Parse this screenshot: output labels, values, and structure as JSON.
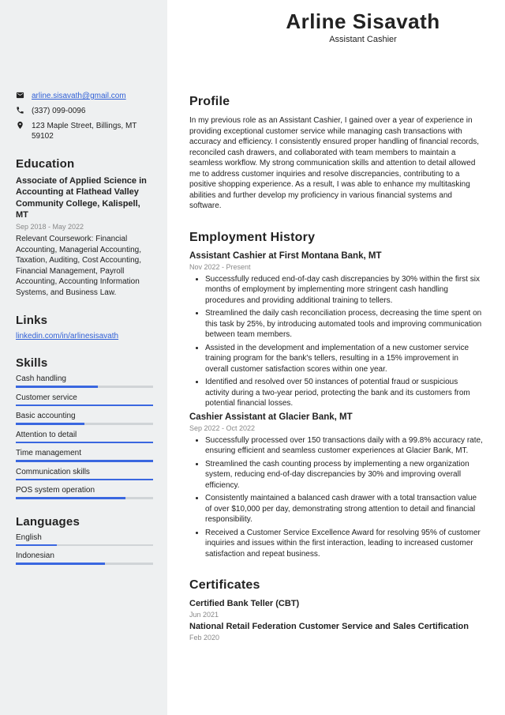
{
  "header": {
    "name": "Arline Sisavath",
    "title": "Assistant Cashier"
  },
  "contact": {
    "email": "arline.sisavath@gmail.com",
    "phone": "(337) 099-0096",
    "address": "123 Maple Street, Billings, MT 59102"
  },
  "education": {
    "heading": "Education",
    "degree": "Associate of Applied Science in Accounting at Flathead Valley Community College, Kalispell, MT",
    "dates": "Sep 2018 - May 2022",
    "coursework": "Relevant Coursework: Financial Accounting, Managerial Accounting, Taxation, Auditing, Cost Accounting, Financial Management, Payroll Accounting, Accounting Information Systems, and Business Law."
  },
  "links": {
    "heading": "Links",
    "url": "linkedin.com/in/arlinesisavath"
  },
  "skills": {
    "heading": "Skills",
    "items": [
      {
        "name": "Cash handling",
        "level": 60
      },
      {
        "name": "Customer service",
        "level": 100
      },
      {
        "name": "Basic accounting",
        "level": 50
      },
      {
        "name": "Attention to detail",
        "level": 100
      },
      {
        "name": "Time management",
        "level": 100
      },
      {
        "name": "Communication skills",
        "level": 100
      },
      {
        "name": "POS system operation",
        "level": 80
      }
    ]
  },
  "languages": {
    "heading": "Languages",
    "items": [
      {
        "name": "English",
        "level": 30
      },
      {
        "name": "Indonesian",
        "level": 65
      }
    ]
  },
  "profile": {
    "heading": "Profile",
    "text": "In my previous role as an Assistant Cashier, I gained over a year of experience in providing exceptional customer service while managing cash transactions with accuracy and efficiency. I consistently ensured proper handling of financial records, reconciled cash drawers, and collaborated with team members to maintain a seamless workflow. My strong communication skills and attention to detail allowed me to address customer inquiries and resolve discrepancies, contributing to a positive shopping experience. As a result, I was able to enhance my multitasking abilities and further develop my proficiency in various financial systems and software."
  },
  "employment": {
    "heading": "Employment History",
    "jobs": [
      {
        "title": "Assistant Cashier at First Montana Bank, MT",
        "dates": "Nov 2022 - Present",
        "bullets": [
          "Successfully reduced end-of-day cash discrepancies by 30% within the first six months of employment by implementing more stringent cash handling procedures and providing additional training to tellers.",
          "Streamlined the daily cash reconciliation process, decreasing the time spent on this task by 25%, by introducing automated tools and improving communication between team members.",
          "Assisted in the development and implementation of a new customer service training program for the bank's tellers, resulting in a 15% improvement in overall customer satisfaction scores within one year.",
          "Identified and resolved over 50 instances of potential fraud or suspicious activity during a two-year period, protecting the bank and its customers from potential financial losses."
        ]
      },
      {
        "title": "Cashier Assistant at Glacier Bank, MT",
        "dates": "Sep 2022 - Oct 2022",
        "bullets": [
          "Successfully processed over 150 transactions daily with a 99.8% accuracy rate, ensuring efficient and seamless customer experiences at Glacier Bank, MT.",
          "Streamlined the cash counting process by implementing a new organization system, reducing end-of-day discrepancies by 30% and improving overall efficiency.",
          "Consistently maintained a balanced cash drawer with a total transaction value of over $10,000 per day, demonstrating strong attention to detail and financial responsibility.",
          "Received a Customer Service Excellence Award for resolving 95% of customer inquiries and issues within the first interaction, leading to increased customer satisfaction and repeat business."
        ]
      }
    ]
  },
  "certificates": {
    "heading": "Certificates",
    "items": [
      {
        "title": "Certified Bank Teller (CBT)",
        "date": "Jun 2021"
      },
      {
        "title": "National Retail Federation Customer Service and Sales Certification",
        "date": "Feb 2020"
      }
    ]
  }
}
